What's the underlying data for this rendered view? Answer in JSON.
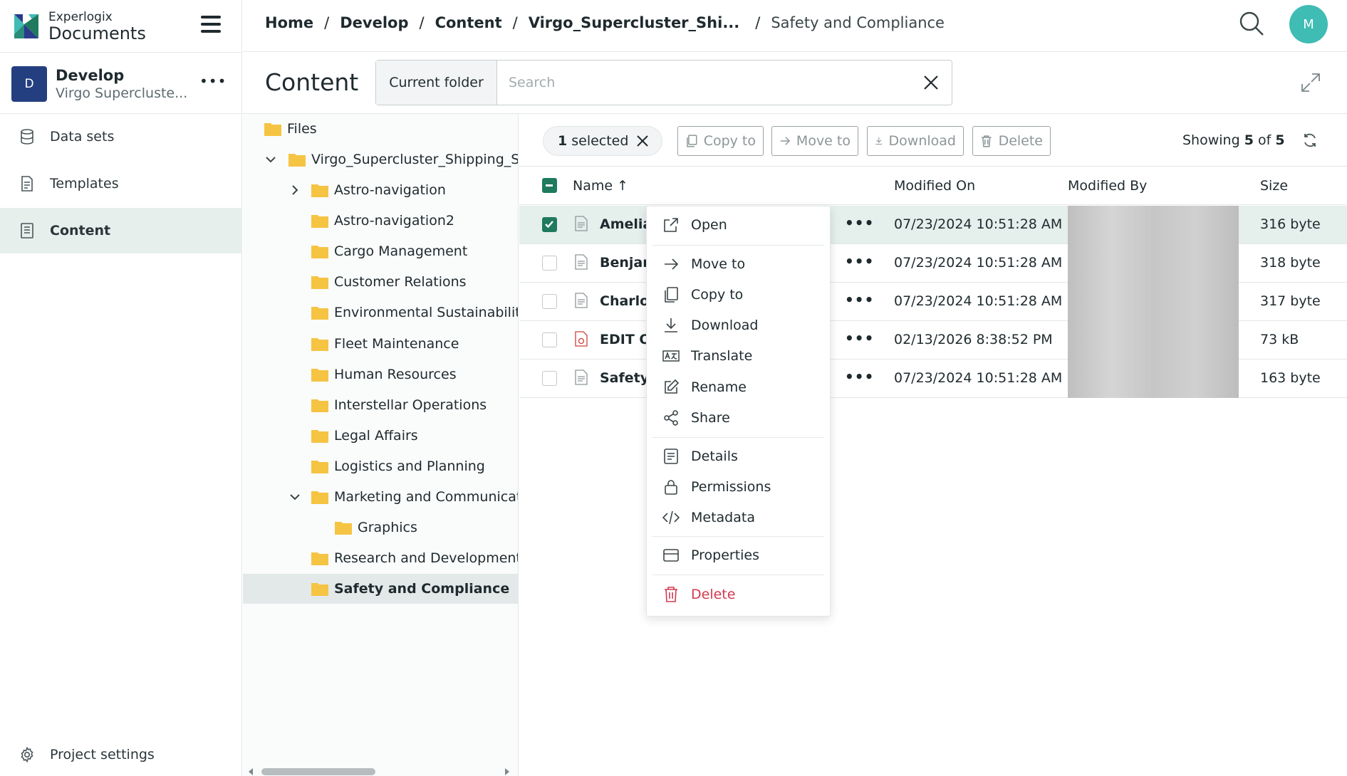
{
  "brand": {
    "company": "Experlogix",
    "product": "Documents",
    "accent": "#1f7a5e"
  },
  "project": {
    "initial": "D",
    "name": "Develop",
    "subtitle": "Virgo Superclustе..."
  },
  "nav": {
    "items": [
      {
        "label": "Data sets",
        "icon": "database-icon"
      },
      {
        "label": "Templates",
        "icon": "template-icon"
      },
      {
        "label": "Content",
        "icon": "content-icon",
        "active": true
      }
    ],
    "settings": "Project settings"
  },
  "breadcrumb": {
    "items": [
      "Home",
      "Develop",
      "Content",
      "Virgo_Supercluster_Shi..."
    ],
    "current": "Safety and Compliance",
    "separator": "/"
  },
  "user": {
    "initial": "M"
  },
  "content": {
    "title": "Content",
    "scope": "Current folder",
    "search_placeholder": "Search"
  },
  "tree": {
    "root": "Files",
    "project_folder": "Virgo_Supercluster_Shipping_Solutions",
    "folders": [
      "Astro-navigation",
      "Astro-navigation2",
      "Cargo Management",
      "Customer Relations",
      "Environmental Sustainability",
      "Fleet Maintenance",
      "Human Resources",
      "Interstellar Operations",
      "Legal Affairs",
      "Logistics and Planning",
      "Marketing and Communications",
      "Graphics",
      "Research and Development",
      "Safety and Compliance"
    ],
    "selected": "Safety and Compliance"
  },
  "toolbar": {
    "selected_count": "1",
    "selected_label": "selected",
    "copy": "Copy to",
    "move": "Move to",
    "download": "Download",
    "delete": "Delete",
    "showing_prefix": "Showing",
    "showing_count": "5",
    "showing_of": "of",
    "showing_total": "5"
  },
  "table": {
    "columns": {
      "name": "Name",
      "sort_icon": "↑",
      "modified_on": "Modified On",
      "modified_by": "Modified By",
      "size": "Size"
    },
    "rows": [
      {
        "name": "Amelia",
        "modified_on": "07/23/2024 10:51:28 AM",
        "size": "316 byte",
        "type": "text",
        "selected": true
      },
      {
        "name": "Benjam",
        "modified_on": "07/23/2024 10:51:28 AM",
        "size": "318 byte",
        "type": "text"
      },
      {
        "name": "Charlot",
        "modified_on": "07/23/2024 10:51:28 AM",
        "size": "317 byte",
        "type": "text"
      },
      {
        "name": "EDIT O",
        "modified_on": "02/13/2026 8:38:52 PM",
        "size": "73 kB",
        "type": "pdf"
      },
      {
        "name": "Safety_",
        "modified_on": "07/23/2024 10:51:28 AM",
        "size": "163 byte",
        "type": "text"
      }
    ]
  },
  "context_menu": {
    "open": "Open",
    "move_to": "Move to",
    "copy_to": "Copy to",
    "download": "Download",
    "translate": "Translate",
    "rename": "Rename",
    "share": "Share",
    "details": "Details",
    "permissions": "Permissions",
    "metadata": "Metadata",
    "properties": "Properties",
    "delete": "Delete"
  }
}
